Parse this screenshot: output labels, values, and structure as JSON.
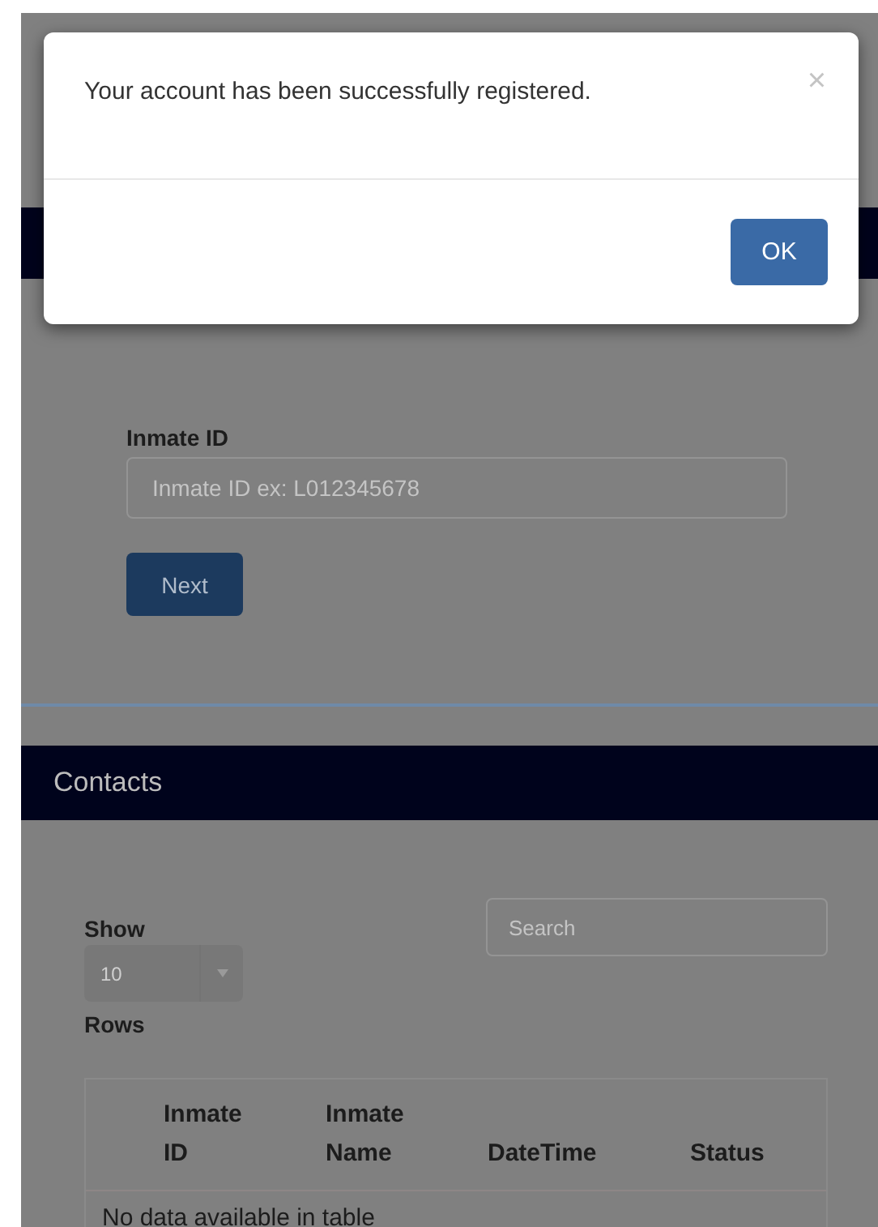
{
  "dialog": {
    "message": "Your account has been successfully registered.",
    "close": "×",
    "button": "OK"
  },
  "form": {
    "label": "Inmate ID",
    "placeholder": "Inmate ID ex: L012345678",
    "button": "Next"
  },
  "contacts": {
    "title": "Contacts",
    "show_label": "Show",
    "rows_value": "10",
    "rows_label": "Rows",
    "search": {
      "placeholder": "Search"
    },
    "table": {
      "columns": [
        "Inmate ID",
        "Inmate Name",
        "DateTime",
        "Status"
      ],
      "empty_message": "No data available in table"
    }
  }
}
